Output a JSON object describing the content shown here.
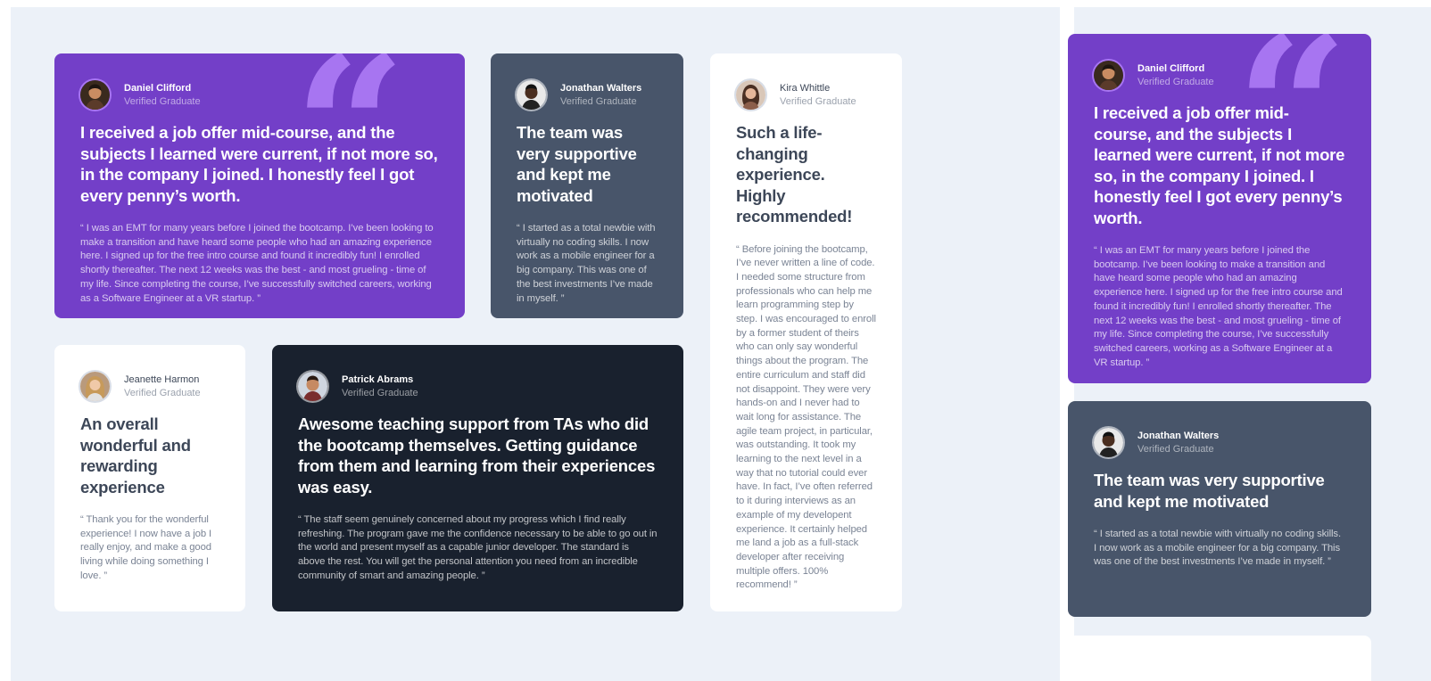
{
  "colors": {
    "page_bg": "#ecf1f8",
    "purple": "#733fc8",
    "slate": "#48556a",
    "dark": "#19212e",
    "white": "#ffffff",
    "quote_mark": "#a775f1"
  },
  "quote_glyph": "“",
  "icons": {
    "quote": "quotation-mark-icon",
    "avatar": "user-avatar"
  },
  "testimonials": {
    "daniel": {
      "name": "Daniel Clifford",
      "status": "Verified Graduate",
      "headline": "I received a job offer mid-course, and the subjects I learned were current, if not more so, in the company I joined. I honestly feel I got every penny’s worth.",
      "body": "“ I was an EMT for many years before I joined the bootcamp. I’ve been looking to make a transition and have heard some people who had an amazing experience here. I signed up for the free intro course and found it incredibly fun! I enrolled shortly thereafter. The next 12 weeks was the best - and most grueling - time of my life. Since completing the course, I’ve successfully switched careers, working as a Software Engineer at a VR startup. ”"
    },
    "jonathan": {
      "name": "Jonathan Walters",
      "status": "Verified Graduate",
      "headline": "The team was very supportive and kept me motivated",
      "body": "“ I started as a total newbie with virtually no coding skills. I now work as a mobile engineer for a big company. This was one of the best investments I’ve made in myself. ”"
    },
    "kira": {
      "name": "Kira Whittle",
      "status": "Verified Graduate",
      "headline": "Such a life-changing experience. Highly recommended!",
      "body": "“ Before joining the bootcamp, I’ve never written a line of code. I needed some structure from professionals who can help me learn programming step by step. I was encouraged to enroll by a former student of theirs who can only say wonderful things about the program. The entire curriculum and staff did not disappoint. They were very hands-on and I never had to wait long for assistance. The agile team project, in particular, was outstanding. It took my learning to the next level in a way that no tutorial could ever have. In fact, I’ve often referred to it during interviews as an example of my developent experience. It certainly helped me land a job as a full-stack developer after receiving multiple offers. 100% recommend! ”"
    },
    "jeanette": {
      "name": "Jeanette Harmon",
      "status": "Verified Graduate",
      "headline": "An overall wonderful and rewarding experience",
      "body": "“ Thank you for the wonderful experience! I now have a job I really enjoy, and make a good living while doing something I love. ”"
    },
    "patrick": {
      "name": "Patrick Abrams",
      "status": "Verified Graduate",
      "headline": "Awesome teaching support from TAs who did the bootcamp themselves. Getting guidance from them and learning from their experiences was easy.",
      "body": "“ The staff seem genuinely concerned about my progress which I find really refreshing. The program gave me the confidence necessary to be able to go out in the world and present myself as a capable junior developer. The standard is above the rest. You will get the personal attention you need from an incredible community of smart and amazing people. ”"
    }
  }
}
